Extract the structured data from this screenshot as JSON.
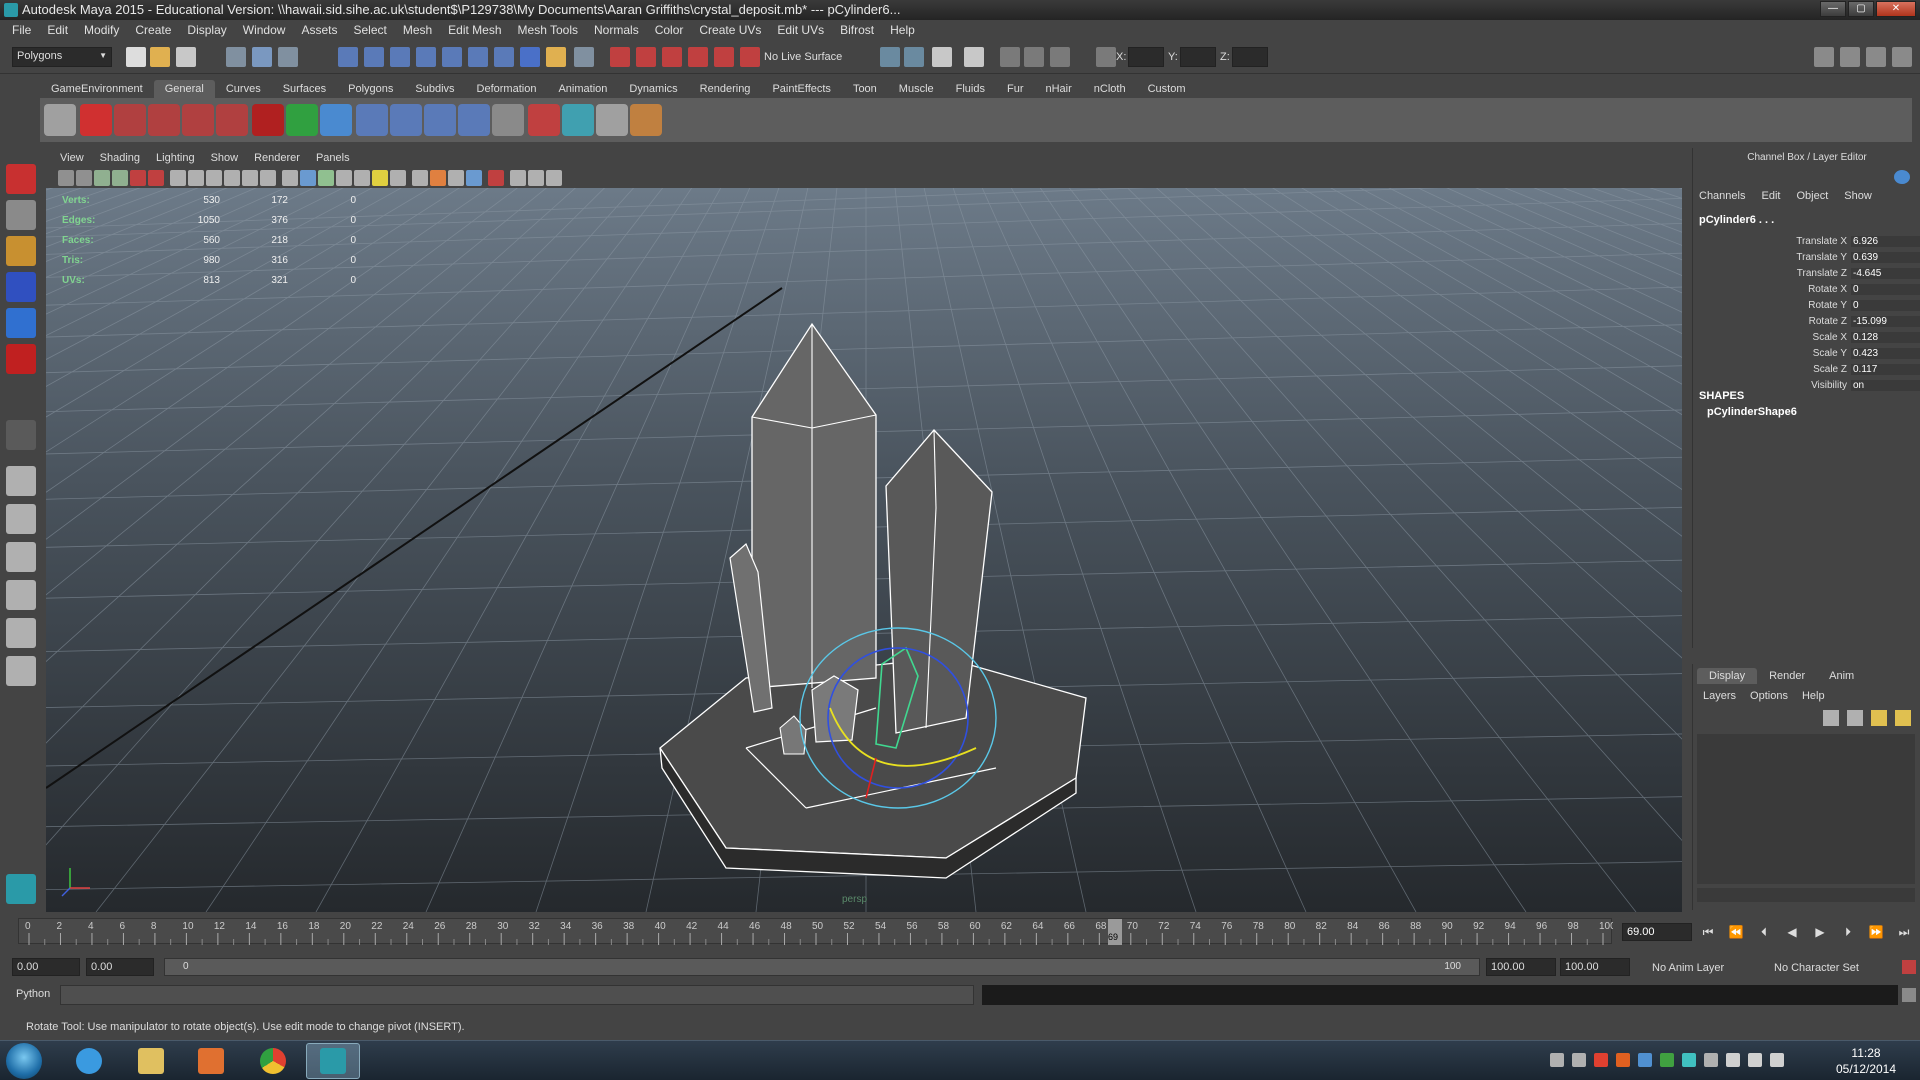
{
  "window": {
    "title": "Autodesk Maya 2015 - Educational Version: \\\\hawaii.sid.sihe.ac.uk\\student$\\P129738\\My Documents\\Aaran Griffiths\\crystal_deposit.mb*   ---   pCylinder6..."
  },
  "menubar": [
    "File",
    "Edit",
    "Modify",
    "Create",
    "Display",
    "Window",
    "Assets",
    "Select",
    "Mesh",
    "Edit Mesh",
    "Mesh Tools",
    "Normals",
    "Color",
    "Create UVs",
    "Edit UVs",
    "Bifrost",
    "Help"
  ],
  "statusline": {
    "mode": "Polygons",
    "live_surface": "No Live Surface",
    "x_label": "X:",
    "y_label": "Y:",
    "z_label": "Z:"
  },
  "shelf": {
    "tabs": [
      "GameEnvironment",
      "General",
      "Curves",
      "Surfaces",
      "Polygons",
      "Subdivs",
      "Deformation",
      "Animation",
      "Dynamics",
      "Rendering",
      "PaintEffects",
      "Toon",
      "Muscle",
      "Fluids",
      "Fur",
      "nHair",
      "nCloth",
      "Custom"
    ],
    "active_tab": "General"
  },
  "panel": {
    "menu": [
      "View",
      "Shading",
      "Lighting",
      "Show",
      "Renderer",
      "Panels"
    ],
    "camera_label": "persp"
  },
  "hud": {
    "rows": [
      {
        "label": "Verts:",
        "values": [
          "530",
          "172",
          "0"
        ]
      },
      {
        "label": "Edges:",
        "values": [
          "1050",
          "376",
          "0"
        ]
      },
      {
        "label": "Faces:",
        "values": [
          "560",
          "218",
          "0"
        ]
      },
      {
        "label": "Tris:",
        "values": [
          "980",
          "316",
          "0"
        ]
      },
      {
        "label": "UVs:",
        "values": [
          "813",
          "321",
          "0"
        ]
      }
    ]
  },
  "channel_box": {
    "header": "Channel Box / Layer Editor",
    "menu": [
      "Channels",
      "Edit",
      "Object",
      "Show"
    ],
    "object": "pCylinder6 . . .",
    "attributes": [
      {
        "name": "Translate X",
        "value": "6.926"
      },
      {
        "name": "Translate Y",
        "value": "0.639"
      },
      {
        "name": "Translate Z",
        "value": "-4.645"
      },
      {
        "name": "Rotate X",
        "value": "0"
      },
      {
        "name": "Rotate Y",
        "value": "0"
      },
      {
        "name": "Rotate Z",
        "value": "-15.099"
      },
      {
        "name": "Scale X",
        "value": "0.128"
      },
      {
        "name": "Scale Y",
        "value": "0.423"
      },
      {
        "name": "Scale Z",
        "value": "0.117"
      },
      {
        "name": "Visibility",
        "value": "on"
      }
    ],
    "shapes_label": "SHAPES",
    "shape_name": "pCylinderShape6"
  },
  "layer_editor": {
    "tabs": [
      "Display",
      "Render",
      "Anim"
    ],
    "active_tab": "Display",
    "menu": [
      "Layers",
      "Options",
      "Help"
    ]
  },
  "time_slider": {
    "ticks": [
      "0",
      "2",
      "4",
      "6",
      "8",
      "10",
      "12",
      "14",
      "16",
      "18",
      "20",
      "22",
      "24",
      "26",
      "28",
      "30",
      "32",
      "34",
      "36",
      "38",
      "40",
      "42",
      "44",
      "46",
      "48",
      "50",
      "52",
      "54",
      "56",
      "58",
      "60",
      "62",
      "64",
      "66",
      "68",
      "70",
      "72",
      "74",
      "76",
      "78",
      "80",
      "82",
      "84",
      "86",
      "88",
      "90",
      "92",
      "94",
      "96",
      "98",
      "100"
    ],
    "current_frame": "69.00",
    "current_marker": "69"
  },
  "range_slider": {
    "start": "0.00",
    "playback_start": "0.00",
    "range_start_label": "0",
    "range_end_label": "100",
    "playback_end": "100.00",
    "end": "100.00",
    "anim_layer": "No Anim Layer",
    "character_set": "No Character Set"
  },
  "command_line": {
    "language": "Python"
  },
  "help_line": "Rotate Tool: Use manipulator to rotate object(s). Use edit mode to change pivot (INSERT).",
  "taskbar": {
    "time": "11:28",
    "date": "05/12/2014"
  },
  "colors": {
    "wire": "#ffffff",
    "hud_label": "#80d490",
    "selected_wire": "#40d890"
  }
}
